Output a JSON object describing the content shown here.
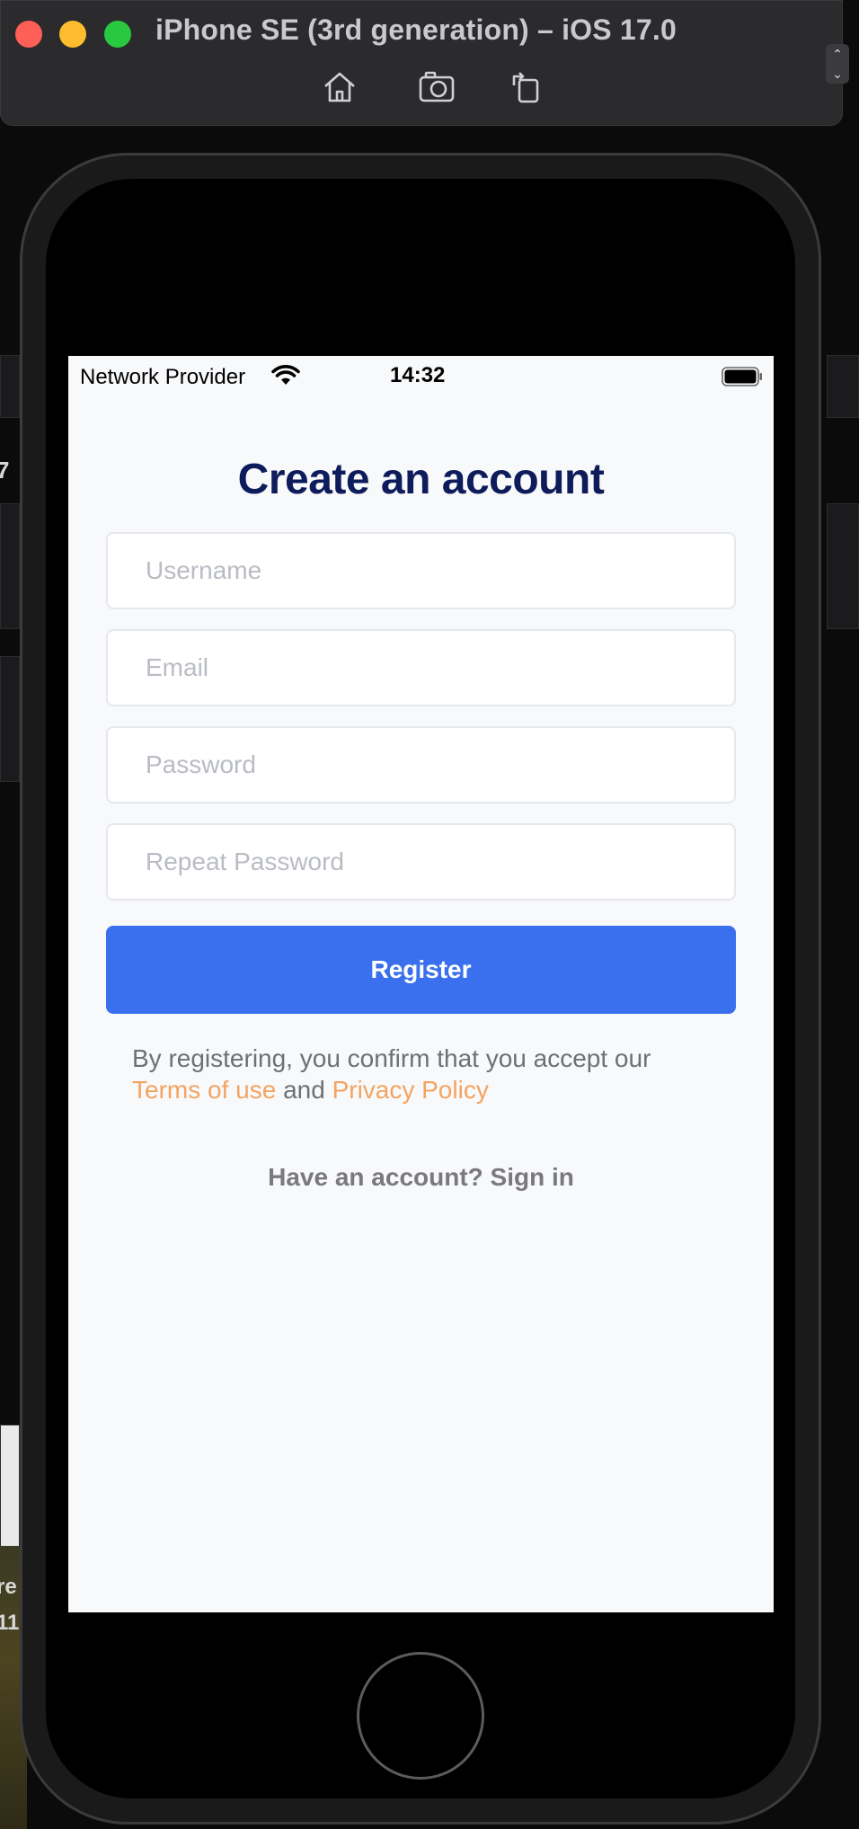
{
  "window": {
    "title": "iPhone SE (3rd generation) – iOS 17.0",
    "toolbar": {
      "home_icon": "home-icon",
      "screenshot_icon": "camera-icon",
      "rotate_icon": "rotate-icon"
    }
  },
  "status_bar": {
    "carrier": "Network Provider",
    "time": "14:32"
  },
  "screen": {
    "title": "Create an account",
    "fields": {
      "username_placeholder": "Username",
      "email_placeholder": "Email",
      "password_placeholder": "Password",
      "repeat_password_placeholder": "Repeat Password"
    },
    "register_label": "Register",
    "terms": {
      "prefix": "By registering, you confirm that you accept our",
      "terms_link": "Terms of use",
      "conjunction": "and",
      "privacy_link": "Privacy Policy"
    },
    "signin_text": "Have an account? Sign in"
  },
  "background": {
    "fragments": [
      "7",
      "re",
      "11"
    ]
  },
  "colors": {
    "title": "#0f1c5c",
    "primary_button": "#3a70ed",
    "link": "#f4a461",
    "screen_background": "#f8f9fb"
  }
}
